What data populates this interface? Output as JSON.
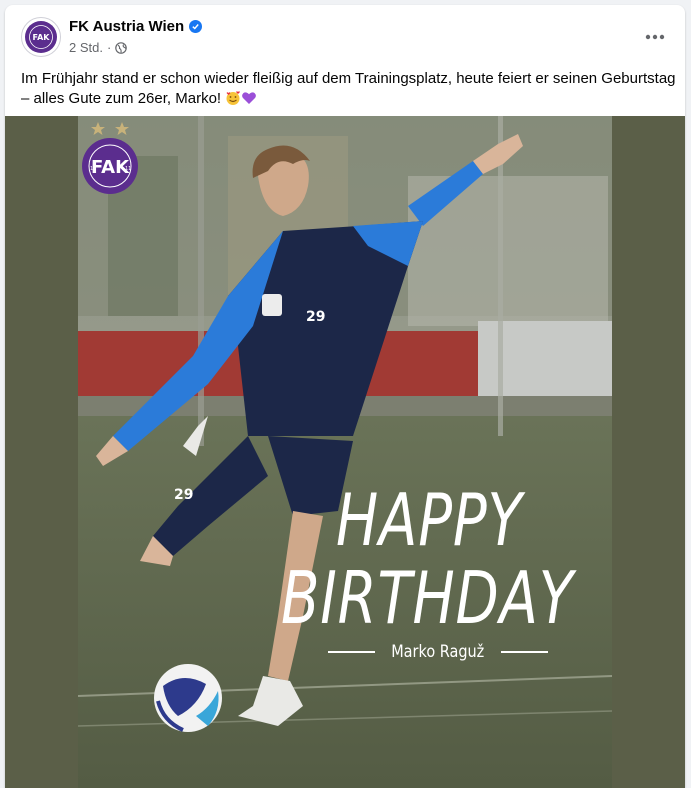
{
  "post": {
    "page_name": "FK Austria Wien",
    "verified_icon": "verified-badge-icon",
    "time": "2 Std.",
    "separator": "·",
    "audience_icon": "globe-icon",
    "text": "Im Frühjahr stand er schon wieder fleißig auf dem Trainingsplatz, heute feiert er seinen Geburtstag – alles Gute zum 26er, Marko! ",
    "emojis": [
      "smiling-face-with-hearts",
      "purple-heart"
    ],
    "more_icon": "more-options-icon"
  },
  "image": {
    "headline_line1": "HAPPY",
    "headline_line2": "BIRTHDAY",
    "player_name": "Marko Raguž",
    "shirt_number": "29",
    "badge_letters": "FAK",
    "badge_ring_text": "FUSSBALLKLUB AUSTRIA WIEN",
    "badge_years": [
      "19",
      "11"
    ],
    "stars": 2
  },
  "colors": {
    "brand_purple": "#5b2d8e",
    "verified_blue": "#1877f2",
    "media_bg": "#5b5f48",
    "kit_blue": "#2b7bd9",
    "kit_navy": "#1c2748"
  }
}
